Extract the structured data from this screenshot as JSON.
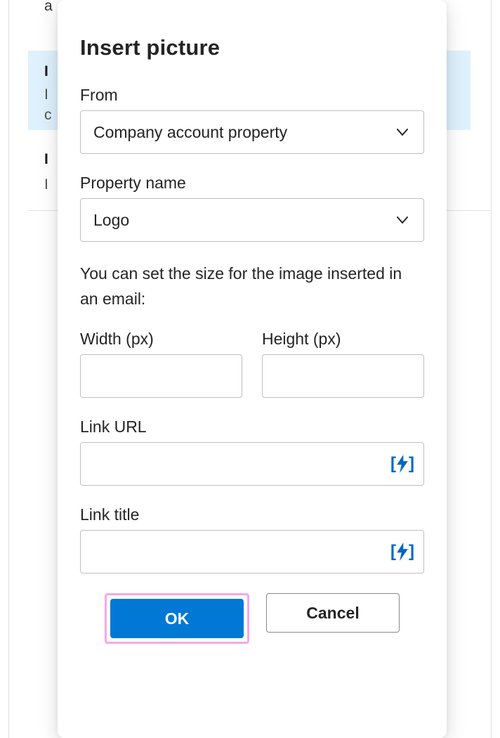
{
  "background": {
    "item_a_text": "a",
    "item_title_1": "I",
    "item_sub_1": "I",
    "item_sub_1b": "c",
    "item_title_2": "I",
    "item_sub_2": "I"
  },
  "modal": {
    "title": "Insert picture",
    "from_label": "From",
    "from_value": "Company account property",
    "property_label": "Property name",
    "property_value": "Logo",
    "help_text": "You can set the size for the image inserted in an email:",
    "width_label": "Width (px)",
    "height_label": "Height (px)",
    "link_url_label": "Link URL",
    "link_title_label": "Link title",
    "ok_label": "OK",
    "cancel_label": "Cancel"
  }
}
